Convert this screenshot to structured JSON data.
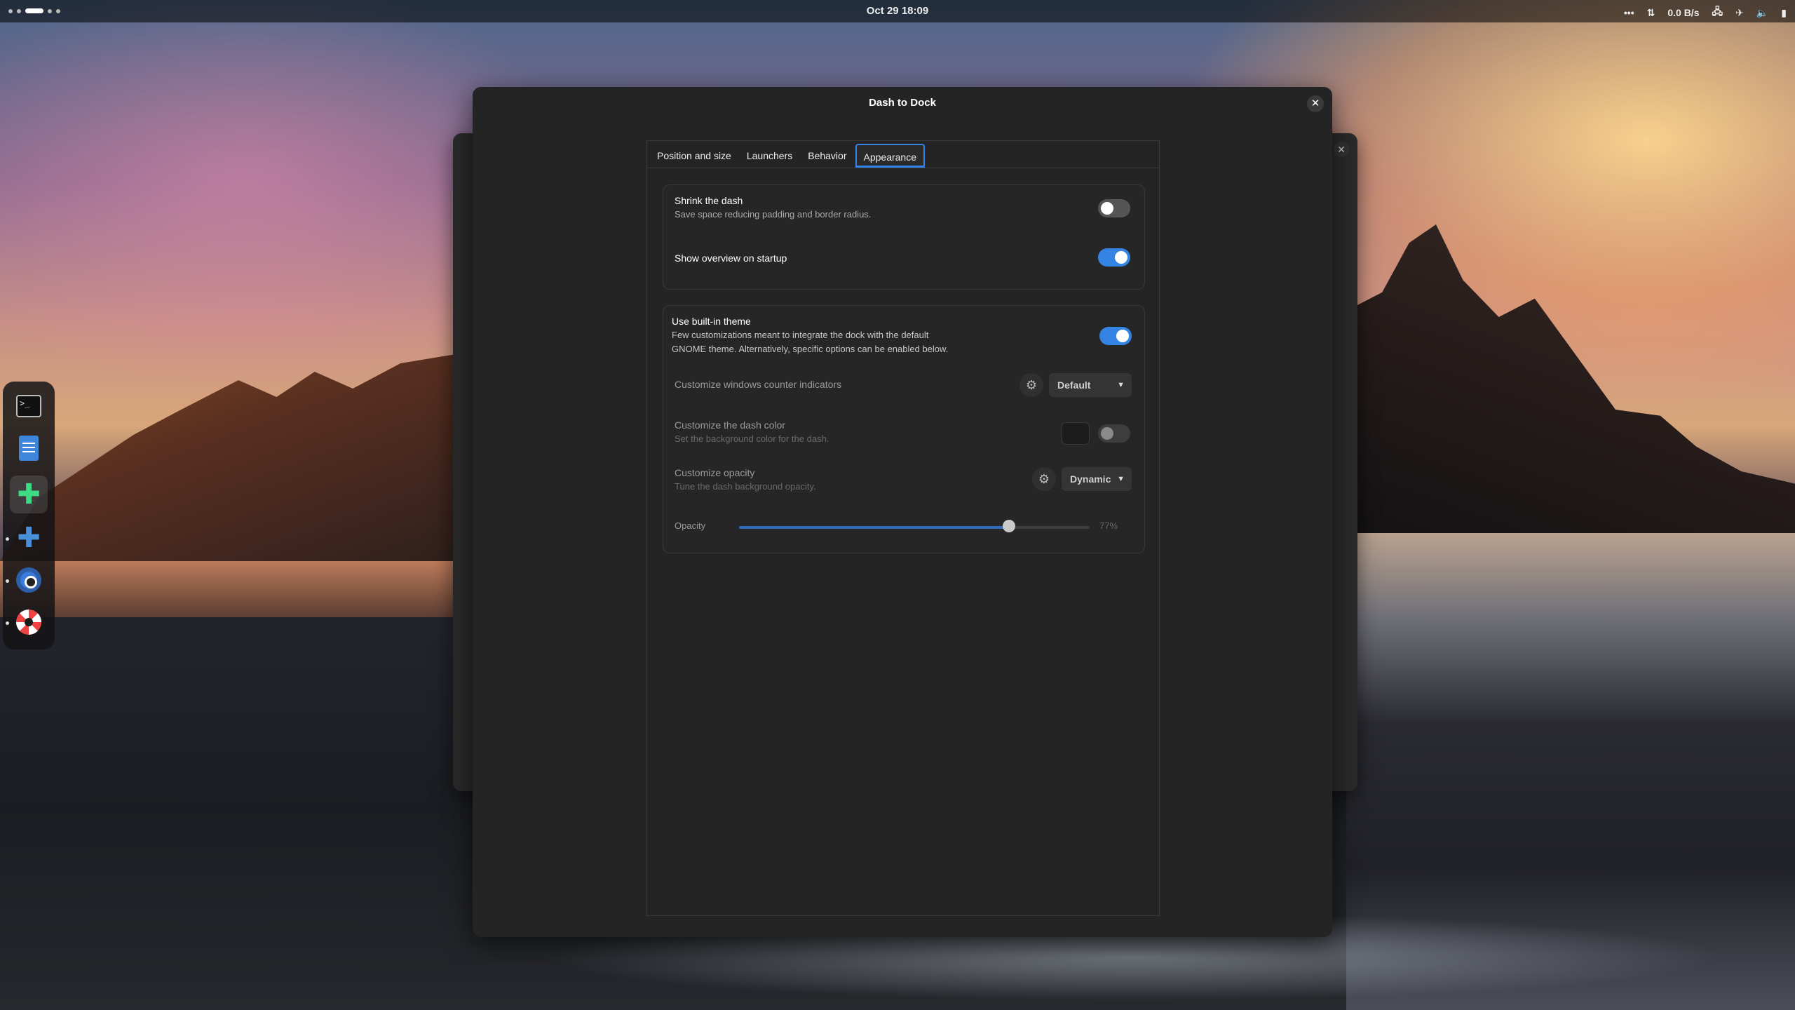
{
  "topbar": {
    "clock": "Oct 29  18:09",
    "netspeed": "0.0  B/s",
    "tray_icons": [
      "overflow-icon",
      "arrows-updown-icon",
      "network-icon",
      "airplane-icon",
      "volume-icon",
      "battery-icon"
    ]
  },
  "dock": {
    "apps": [
      "terminal-icon",
      "notes-icon",
      "extension-manager-icon",
      "extensions-icon",
      "chromium-icon",
      "lifebuoy-icon"
    ]
  },
  "window": {
    "title": "Dash to Dock",
    "close_label": "✕"
  },
  "tabs": [
    {
      "label": "Position and size"
    },
    {
      "label": "Launchers"
    },
    {
      "label": "Behavior"
    },
    {
      "label": "Appearance",
      "active": true
    }
  ],
  "group1": {
    "shrink": {
      "title": "Shrink the dash",
      "subtitle": "Save space reducing padding and border radius.",
      "enabled": false
    },
    "overview": {
      "title": "Show overview on startup",
      "enabled": true
    }
  },
  "group2": {
    "builtin": {
      "title": "Use built-in theme",
      "subtitle_line1": "Few customizations meant to integrate the dock with the default",
      "subtitle_line2": "GNOME theme. Alternatively, specific options can be enabled below.",
      "enabled": true
    },
    "counter": {
      "title": "Customize windows counter indicators",
      "selected": "Default"
    },
    "dashcolor": {
      "title": "Customize the dash color",
      "subtitle": "Set the background color for the dash.",
      "enabled": false
    },
    "opacity_mode": {
      "title": "Customize opacity",
      "subtitle": "Tune the dash background opacity.",
      "selected": "Dynamic"
    },
    "opacity": {
      "label": "Opacity",
      "value_text": "77%",
      "value": 0.77
    }
  },
  "colors": {
    "accent": "#3584e4"
  }
}
